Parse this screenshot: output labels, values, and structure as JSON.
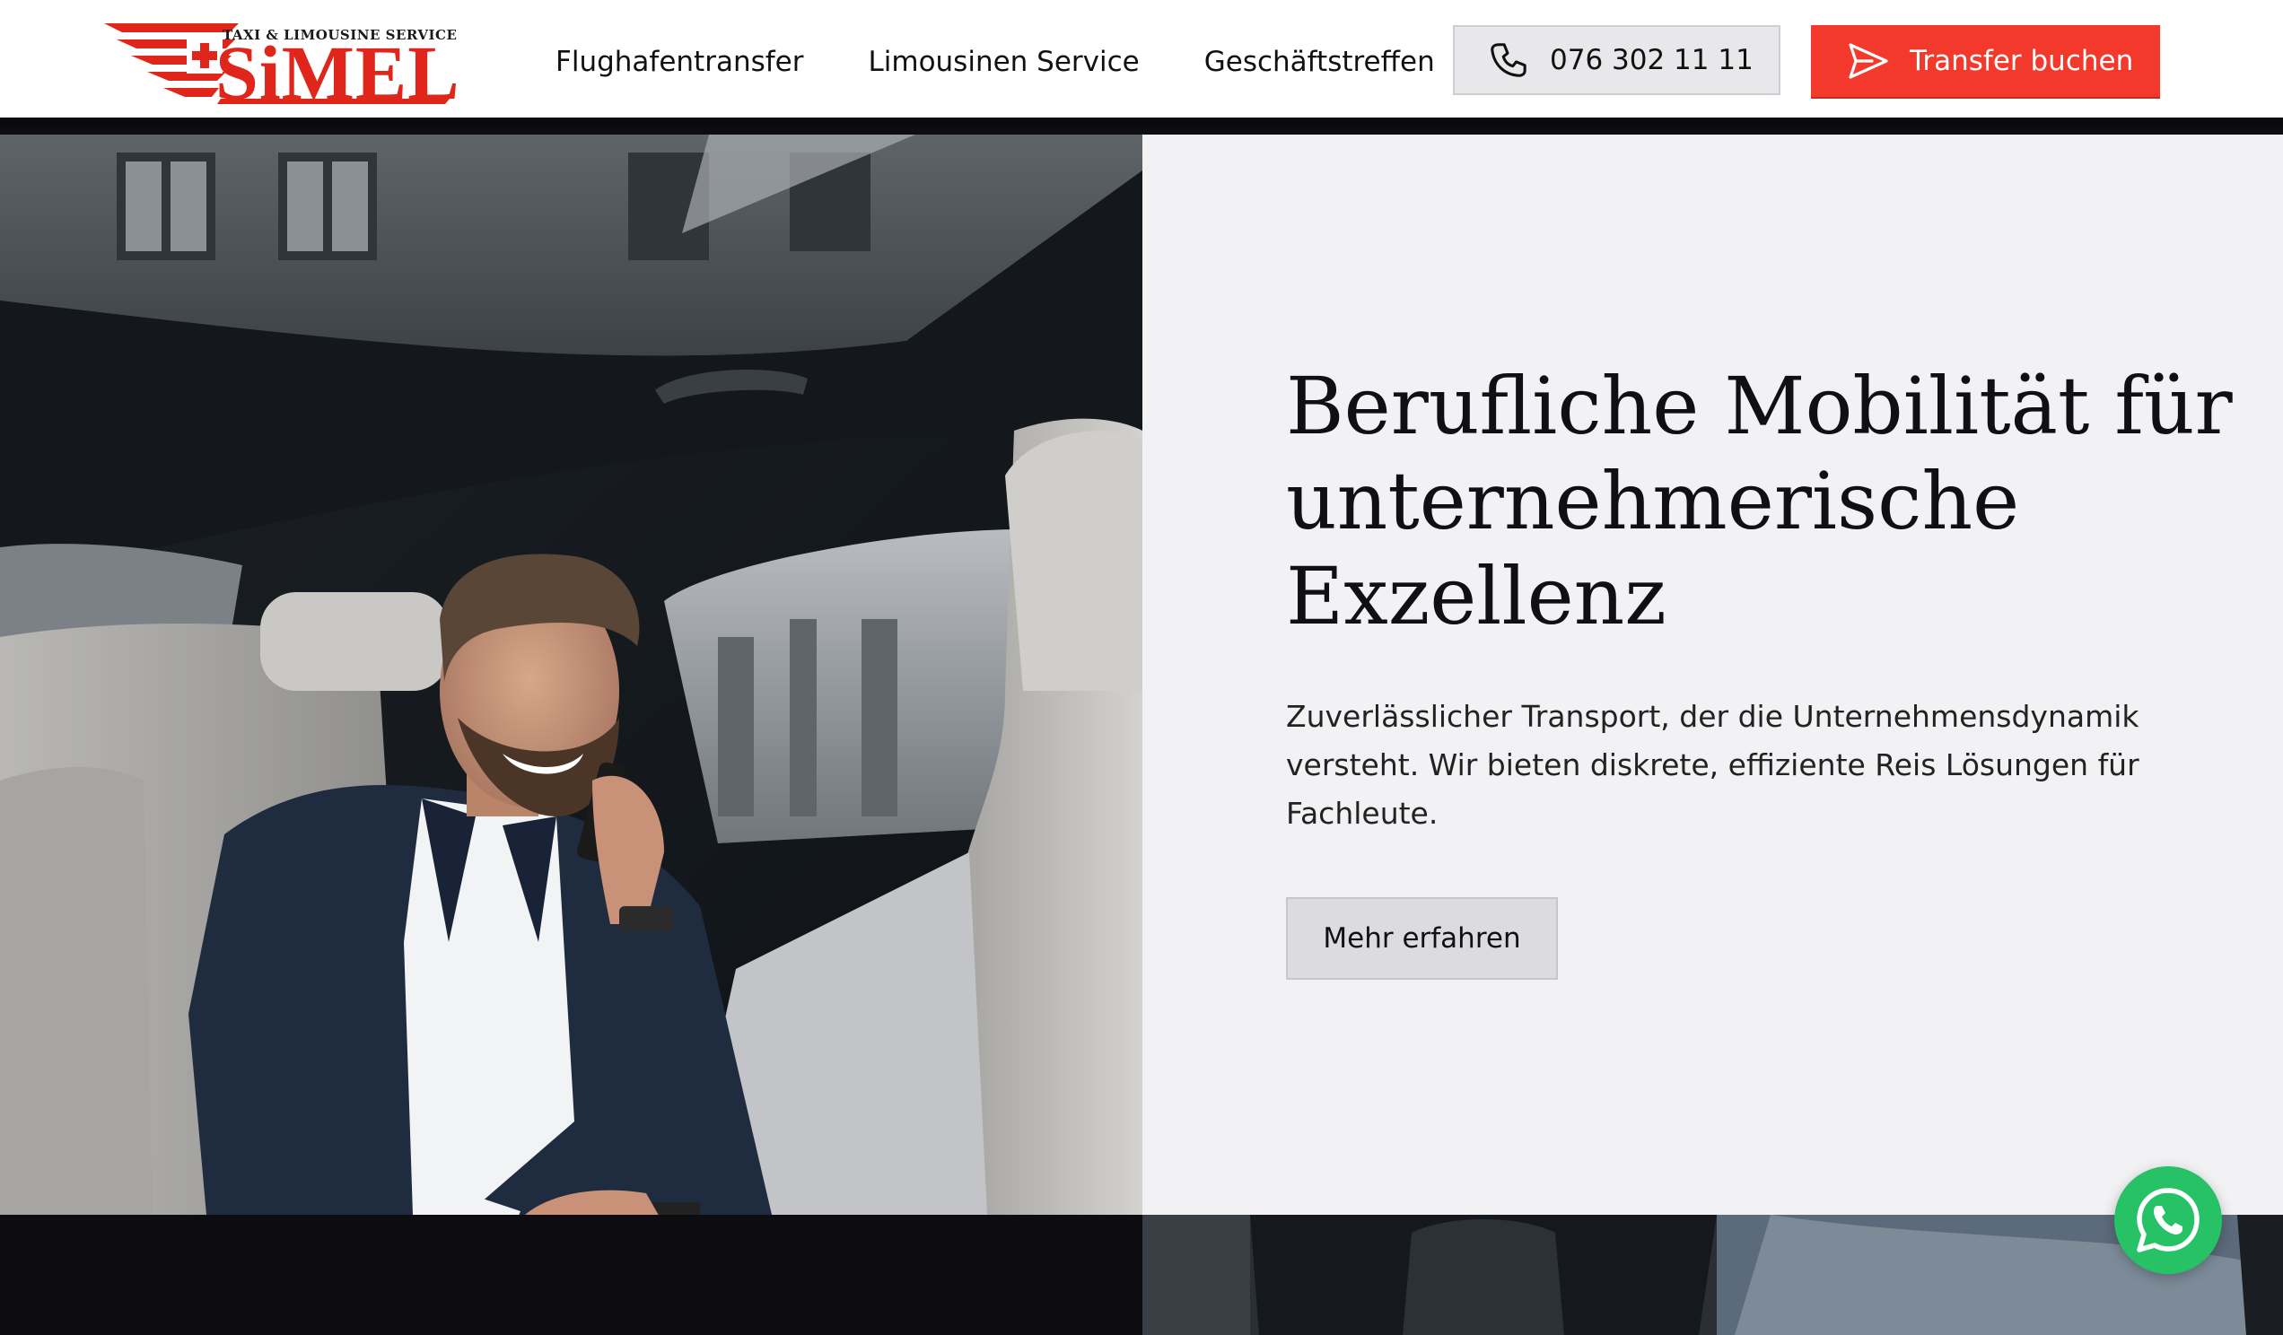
{
  "brand": {
    "tagline": "TAXI & LIMOUSINE SERVICE",
    "name": "SiMEL",
    "accent_color": "#e0251b"
  },
  "nav": {
    "items": [
      {
        "label": "Flughafentransfer"
      },
      {
        "label": "Limousinen Service"
      },
      {
        "label": "Geschäftstreffen"
      }
    ]
  },
  "header": {
    "phone": {
      "icon": "phone-icon",
      "label": "076 302 11 11"
    },
    "book": {
      "icon": "send-icon",
      "label": "Transfer buchen",
      "color": "#f2392b"
    }
  },
  "hero": {
    "title": "Berufliche Mobilität für unternehmerische Exzellenz",
    "text": "Zuverlässlicher Transport, der die Unternehmensdynamik versteht. Wir bieten diskrete, effiziente Reis Lösungen für Fachleute.",
    "cta": "Mehr erfahren",
    "panel_color": "#f2f1f4"
  },
  "floating": {
    "whatsapp": {
      "icon": "whatsapp-icon",
      "color": "#27c265"
    }
  }
}
